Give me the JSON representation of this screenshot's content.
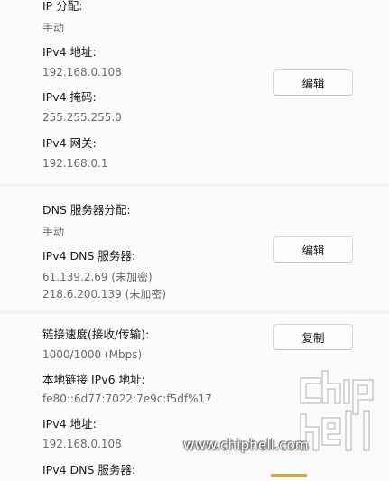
{
  "ip_section": {
    "assignment_label": "IP 分配:",
    "assignment_value": "手动",
    "ipv4_address_label": "IPv4 地址:",
    "ipv4_address_value": "192.168.0.108",
    "ipv4_mask_label": "IPv4 掩码:",
    "ipv4_mask_value": "255.255.255.0",
    "ipv4_gateway_label": "IPv4 网关:",
    "ipv4_gateway_value": "192.168.0.1",
    "edit_button": "编辑"
  },
  "dns_section": {
    "assignment_label": "DNS 服务器分配:",
    "assignment_value": "手动",
    "ipv4_dns_label": "IPv4 DNS 服务器:",
    "dns_primary": "61.139.2.69 (未加密)",
    "dns_secondary": "218.6.200.139 (未加密)",
    "edit_button": "编辑"
  },
  "properties_section": {
    "link_speed_label": "链接速度(接收/传输):",
    "link_speed_value": "1000/1000 (Mbps)",
    "ipv6_local_label": "本地链接 IPv6 地址:",
    "ipv6_local_value": "fe80::6d77:7022:7e9c:f5df%17",
    "ipv4_address_label": "IPv4 地址:",
    "ipv4_address_value": "192.168.0.108",
    "ipv4_dns_label": "IPv4 DNS 服务器:",
    "copy_button": "复制"
  },
  "watermark": {
    "url": "www.chiphell.com",
    "logo_icon": "chiphell-logo-icon",
    "accent_color": "#d7a640"
  }
}
